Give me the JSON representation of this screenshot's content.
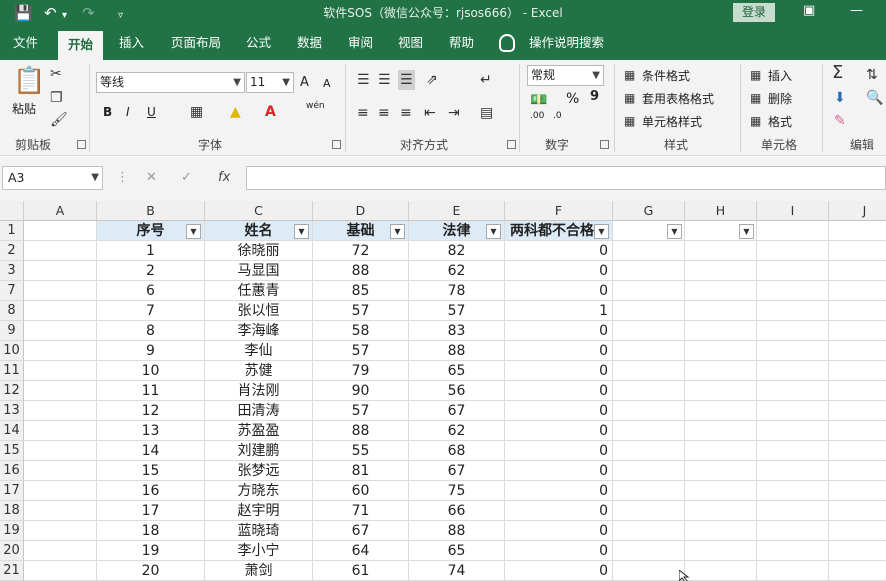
{
  "title_bar": {
    "title": "软件SOS（微信公众号：rjsos666） -  Excel",
    "login_label": "登录",
    "icons": [
      "save-icon",
      "undo-icon",
      "redo-icon",
      "customize-qat-icon",
      "ribbon-display-icon",
      "minimize-icon"
    ]
  },
  "tabs": [
    "文件",
    "开始",
    "插入",
    "页面布局",
    "公式",
    "数据",
    "审阅",
    "视图",
    "帮助"
  ],
  "tell_me": "操作说明搜索",
  "ribbon": {
    "clipboard": {
      "paste": "粘贴",
      "label": "剪贴板"
    },
    "font": {
      "name": "等线",
      "size": "11",
      "grow": "A",
      "shrink": "A",
      "bold": "B",
      "italic": "I",
      "underline": "U",
      "label": "字体",
      "wen": "wén"
    },
    "alignment": {
      "label": "对齐方式"
    },
    "number": {
      "format": "常规",
      "percent": "%",
      "comma": "9",
      "label": "数字",
      "inc_dec": ".00",
      "dec_dec": ".0"
    },
    "styles": {
      "conditional": "条件格式",
      "table": "套用表格格式",
      "cell": "单元格样式",
      "label": "样式"
    },
    "cells": {
      "insert": "插入",
      "delete": "删除",
      "format": "格式",
      "label": "单元格"
    },
    "editing": {
      "label": "编辑"
    }
  },
  "formula_bar": {
    "name_box": "A3",
    "fx": "fx",
    "value": ""
  },
  "grid": {
    "columns": [
      "A",
      "B",
      "C",
      "D",
      "E",
      "F",
      "G",
      "H",
      "I",
      "J"
    ],
    "header_row_number": "1",
    "headers": [
      "序号",
      "姓名",
      "基础",
      "法律",
      "两科都不合格"
    ],
    "rows": [
      {
        "row": "2",
        "b": "1",
        "c": "徐晓丽",
        "d": "72",
        "e": "82",
        "f": "0"
      },
      {
        "row": "3",
        "b": "2",
        "c": "马显国",
        "d": "88",
        "e": "62",
        "f": "0"
      },
      {
        "row": "7",
        "b": "6",
        "c": "任蕙青",
        "d": "85",
        "e": "78",
        "f": "0"
      },
      {
        "row": "8",
        "b": "7",
        "c": "张以恒",
        "d": "57",
        "e": "57",
        "f": "1"
      },
      {
        "row": "9",
        "b": "8",
        "c": "李海峰",
        "d": "58",
        "e": "83",
        "f": "0"
      },
      {
        "row": "10",
        "b": "9",
        "c": "李仙",
        "d": "57",
        "e": "88",
        "f": "0"
      },
      {
        "row": "11",
        "b": "10",
        "c": "苏健",
        "d": "79",
        "e": "65",
        "f": "0"
      },
      {
        "row": "12",
        "b": "11",
        "c": "肖法刚",
        "d": "90",
        "e": "56",
        "f": "0"
      },
      {
        "row": "13",
        "b": "12",
        "c": "田清涛",
        "d": "57",
        "e": "67",
        "f": "0"
      },
      {
        "row": "14",
        "b": "13",
        "c": "苏盈盈",
        "d": "88",
        "e": "62",
        "f": "0"
      },
      {
        "row": "15",
        "b": "14",
        "c": "刘建鹏",
        "d": "55",
        "e": "68",
        "f": "0"
      },
      {
        "row": "16",
        "b": "15",
        "c": "张梦远",
        "d": "81",
        "e": "67",
        "f": "0"
      },
      {
        "row": "17",
        "b": "16",
        "c": "方晓东",
        "d": "60",
        "e": "75",
        "f": "0"
      },
      {
        "row": "18",
        "b": "17",
        "c": "赵宇明",
        "d": "71",
        "e": "66",
        "f": "0"
      },
      {
        "row": "19",
        "b": "18",
        "c": "蓝晓琦",
        "d": "67",
        "e": "88",
        "f": "0"
      },
      {
        "row": "20",
        "b": "19",
        "c": "李小宁",
        "d": "64",
        "e": "65",
        "f": "0"
      },
      {
        "row": "21",
        "b": "20",
        "c": "萧剑",
        "d": "61",
        "e": "74",
        "f": "0"
      }
    ]
  },
  "colors": {
    "excel_green": "#217346",
    "header_fill": "#ddebf7",
    "ribbon_bg": "#f3f3f3"
  }
}
